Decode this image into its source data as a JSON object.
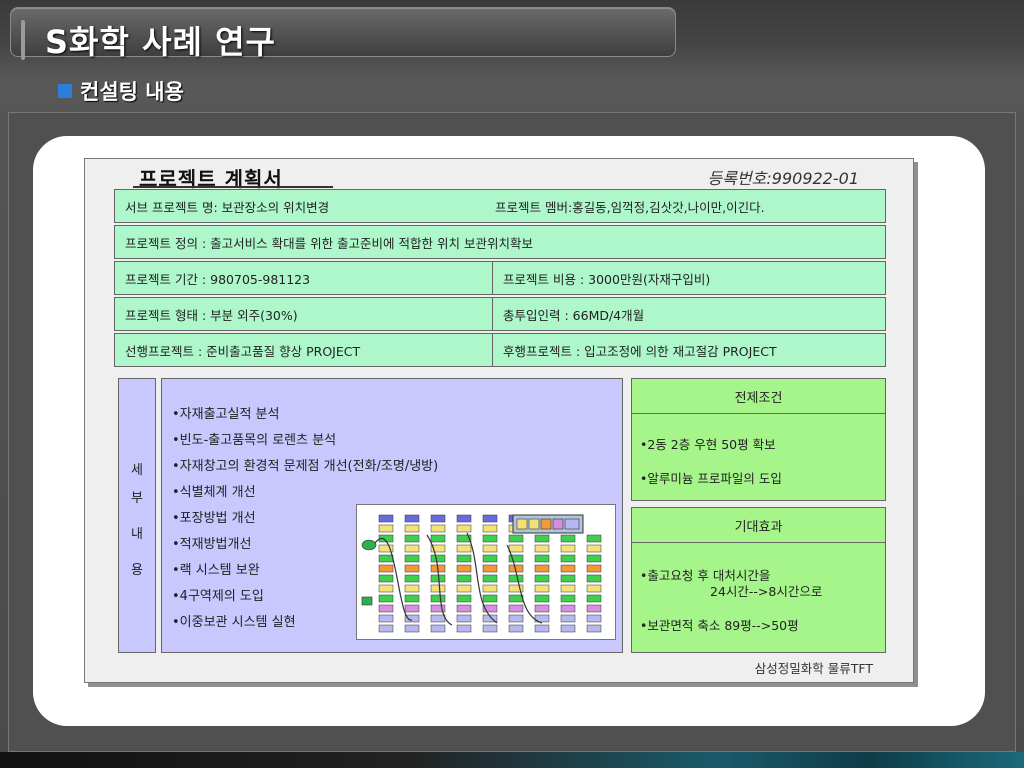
{
  "slide": {
    "title": "S화학 사례 연구",
    "subheading": "컨설팅 내용"
  },
  "doc": {
    "title": "프로젝트 계획서",
    "reg_no": "등록번호:990922-01",
    "rows": [
      {
        "cells": [
          "서브 프로젝트 명: 보관장소의 위치변경",
          "프로젝트 멤버:홍길동,임꺽정,김삿갓,나이만,이긴다."
        ]
      },
      {
        "cells": [
          "프로젝트 정의   : 출고서비스 확대를 위한 출고준비에 적합한 위치 보관위치확보"
        ]
      },
      {
        "cells": [
          "프로젝트 기간   : 980705-981123",
          "프로젝트 비용 : 3000만원(자재구입비)"
        ]
      },
      {
        "cells": [
          "프로젝트 형태   : 부분 외주(30%)",
          "총투입인력    : 66MD/4개월"
        ]
      },
      {
        "cells": [
          "선행프로젝트    : 준비출고품질 향상 PROJECT",
          "후행프로젝트  : 입고조정에 의한 재고절감 PROJECT"
        ]
      }
    ],
    "detail_label": [
      "세",
      "부",
      "내",
      "용"
    ],
    "detail_items": [
      "•자재출고실적 분석",
      "•빈도-출고품목의 로렌츠 분석",
      "•자재창고의 환경적 문제점 개선(전화/조명/냉방)",
      "•식별체계 개선",
      "•포장방법 개선",
      "•적재방법개선",
      "•랙 시스템 보완",
      "•4구역제의 도입",
      "•이중보관 시스템 실현"
    ],
    "precondition": {
      "header": "전제조건",
      "items": [
        "•2동 2층 우현 50평 확보",
        "•알루미늄 프로파일의 도입"
      ]
    },
    "expected": {
      "header": "기대효과",
      "items": [
        "•출고요청 후 대처시간을",
        "24시간-->8시간으로",
        "•보관면적 축소  89평-->50평"
      ]
    },
    "footer": "삼성정밀화학 물류TFT"
  },
  "colors": {
    "row_green": "#aef7ca",
    "box_green": "#a6f58a",
    "detail_purple": "#c8c8ff",
    "bullet_blue": "#2c7fd6"
  }
}
